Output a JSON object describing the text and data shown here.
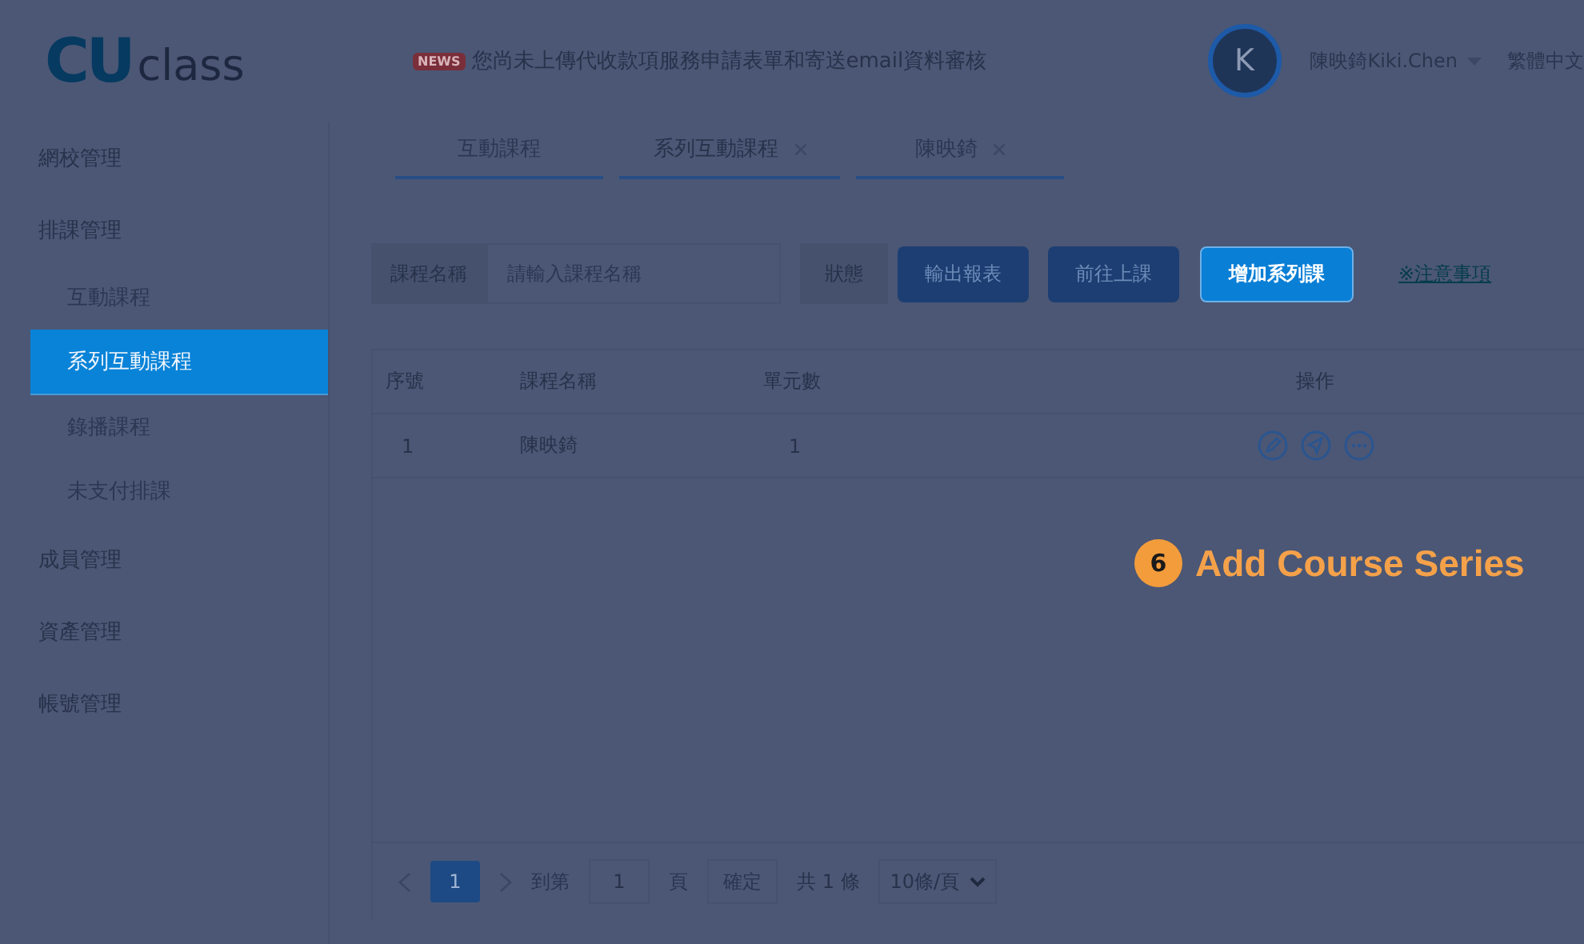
{
  "logo": {
    "mark": "CU",
    "text": "class"
  },
  "notice": {
    "badge": "NEWS",
    "text": "您尚未上傳代收款項服務申請表單和寄送email資料審核"
  },
  "user": {
    "avatar": "K",
    "name": "陳映錡Kiki.Chen",
    "language": "繁體中文"
  },
  "sidebar": {
    "items": [
      {
        "label": "網校管理",
        "selected": false
      },
      {
        "label": "排課管理",
        "selected": false,
        "children": [
          {
            "label": "互動課程",
            "selected": false
          },
          {
            "label": "系列互動課程",
            "selected": true
          },
          {
            "label": "錄播課程",
            "selected": false
          },
          {
            "label": "未支付排課",
            "selected": false
          }
        ]
      },
      {
        "label": "成員管理",
        "selected": false
      },
      {
        "label": "資產管理",
        "selected": false
      },
      {
        "label": "帳號管理",
        "selected": false
      }
    ]
  },
  "tabs": [
    {
      "label": "互動課程",
      "closable": false,
      "selected": false
    },
    {
      "label": "系列互動課程",
      "closable": true,
      "selected": true
    },
    {
      "label": "陳映錡",
      "closable": true,
      "selected": false
    }
  ],
  "filter": {
    "name_label": "課程名稱",
    "placeholder": "請輸入課程名稱",
    "status_label": "狀態"
  },
  "buttons": [
    {
      "label": "輸出報表",
      "highlighted": false
    },
    {
      "label": "前往上課",
      "highlighted": false
    },
    {
      "label": "增加系列課",
      "highlighted": true
    }
  ],
  "notes_link": "※注意事項",
  "table": {
    "columns": [
      "序號",
      "課程名稱",
      "單元數",
      "操作"
    ],
    "rows": [
      {
        "index": "1",
        "name": "陳映錡",
        "units": "1"
      }
    ]
  },
  "pagination": {
    "current": "1",
    "goto_label": "到第",
    "goto_value": "1",
    "page_label": "頁",
    "confirm": "確定",
    "total": "共 1 條",
    "page_size": "10條/頁"
  },
  "callout": {
    "number": "6",
    "text": "Add Course Series"
  }
}
